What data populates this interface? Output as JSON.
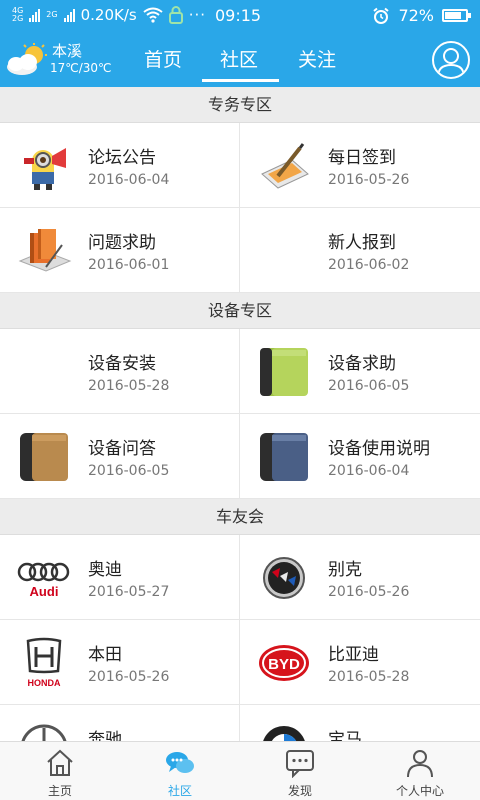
{
  "status_bar": {
    "network_top": "4G",
    "network_bottom": "2G",
    "network_top2": "2G",
    "speed": "0.20K/s",
    "time": "09:15",
    "battery": "72%",
    "battery_level": 0.72
  },
  "header": {
    "weather": {
      "city": "本溪",
      "temp": "17℃/30℃",
      "icon": "partly-cloudy-icon"
    },
    "tabs": [
      {
        "label": "首页"
      },
      {
        "label": "社区"
      },
      {
        "label": "关注"
      }
    ],
    "active_tab": 1,
    "colors": {
      "primary": "#2aa7e8"
    }
  },
  "sections": [
    {
      "title": "专务专区",
      "items": [
        {
          "title": "论坛公告",
          "date": "2016-06-04",
          "icon": "minion-megaphone-icon"
        },
        {
          "title": "每日签到",
          "date": "2016-05-26",
          "icon": "notepad-pen-icon"
        },
        {
          "title": "问题求助",
          "date": "2016-06-01",
          "icon": "books-icon"
        },
        {
          "title": "新人报到",
          "date": "2016-06-02",
          "icon": ""
        }
      ]
    },
    {
      "title": "设备专区",
      "items": [
        {
          "title": "设备安装",
          "date": "2016-05-28",
          "icon": ""
        },
        {
          "title": "设备求助",
          "date": "2016-06-05",
          "icon": "green-notebook-icon"
        },
        {
          "title": "设备问答",
          "date": "2016-06-05",
          "icon": "brown-notebook-icon"
        },
        {
          "title": "设备使用说明",
          "date": "2016-06-04",
          "icon": "blue-notebook-icon"
        }
      ]
    },
    {
      "title": "车友会",
      "items": [
        {
          "title": "奥迪",
          "date": "2016-05-27",
          "icon": "audi-logo-icon",
          "logo_text": "Audi"
        },
        {
          "title": "别克",
          "date": "2016-05-26",
          "icon": "buick-logo-icon"
        },
        {
          "title": "本田",
          "date": "2016-05-26",
          "icon": "honda-logo-icon",
          "logo_text": "HONDA"
        },
        {
          "title": "比亚迪",
          "date": "2016-05-28",
          "icon": "byd-logo-icon",
          "logo_text": "BYD"
        },
        {
          "title": "奔驰",
          "date": "",
          "icon": "mercedes-logo-icon"
        },
        {
          "title": "宝马",
          "date": "",
          "icon": "bmw-logo-icon"
        }
      ]
    }
  ],
  "bottom_nav": [
    {
      "label": "主页",
      "icon": "home-icon"
    },
    {
      "label": "社区",
      "icon": "chat-bubbles-icon"
    },
    {
      "label": "发现",
      "icon": "message-icon"
    },
    {
      "label": "个人中心",
      "icon": "person-icon"
    }
  ]
}
